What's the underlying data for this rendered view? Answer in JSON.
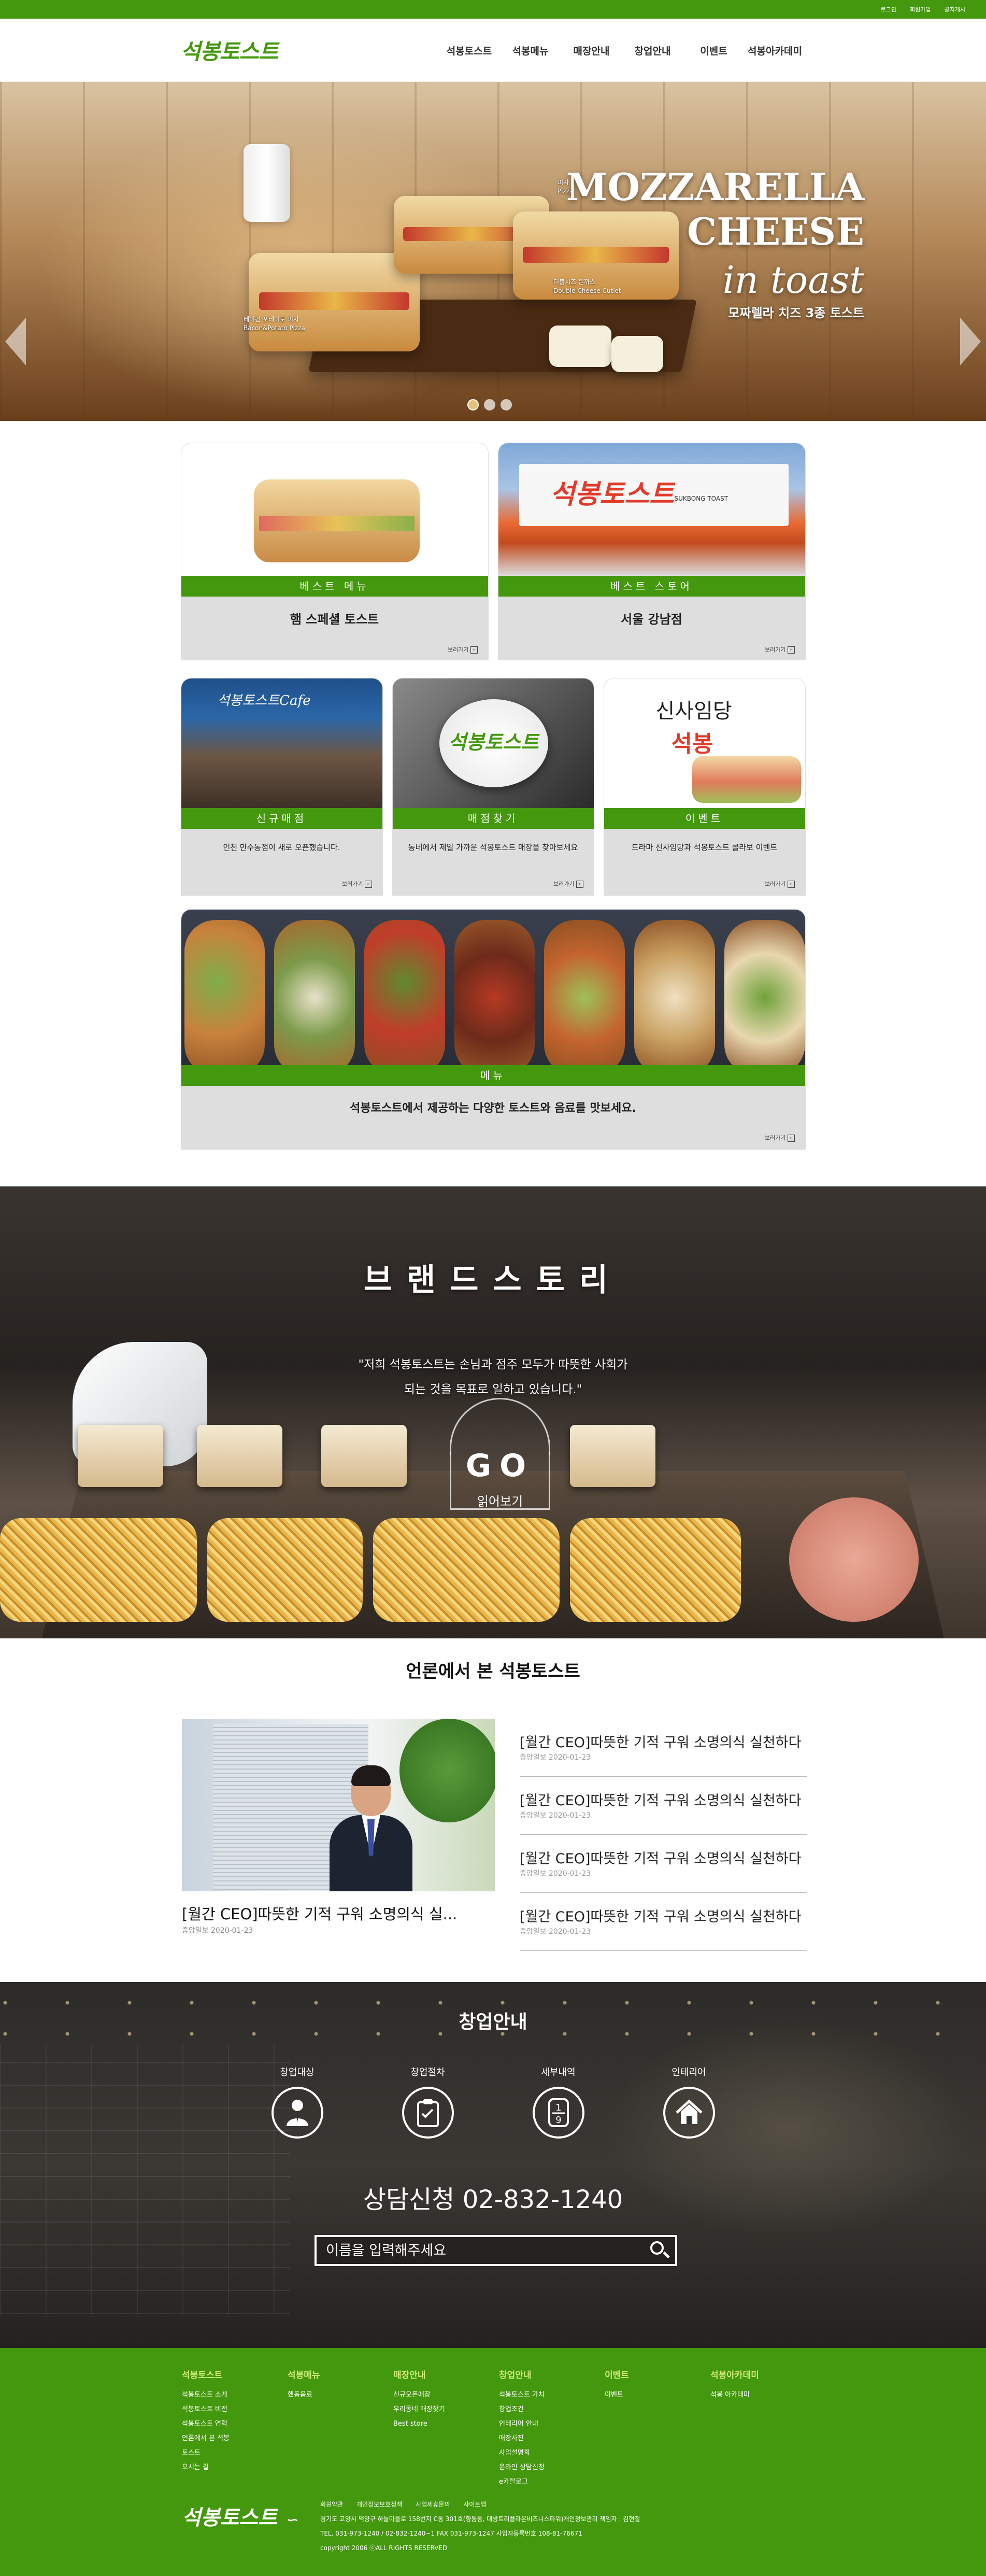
{
  "topbar": {
    "links": [
      "로그인",
      "회원가입",
      "공지게시"
    ]
  },
  "header": {
    "logo": "석봉토스트",
    "nav": [
      "석봉토스트",
      "석봉메뉴",
      "매장안내",
      "창업안내",
      "이벤트",
      "석봉아카데미"
    ]
  },
  "hero": {
    "title_line1": "MOZZARELLA",
    "title_line2": "CHEESE",
    "title_script": "in toast",
    "subtitle": "모짜렐라 치즈 3종 토스트",
    "labels": {
      "pizza": "피자",
      "pizza_en": "Pizza",
      "double_cheese": "더블치즈 돈까스",
      "double_cheese_en": "Double Cheese Cutlet",
      "bacon": "베이컨 포테이토 피자",
      "bacon_en": "Bacon&Potato Pizza"
    },
    "slides_total": 3,
    "active_slide": 1
  },
  "cards": {
    "best_menu": {
      "band": "베스트 메뉴",
      "title": "햄 스페셜 토스트",
      "more": "보러가기"
    },
    "best_store": {
      "band": "베스트 스토어",
      "title": "서울 강남점",
      "more": "보러가기",
      "sign": "석봉토스트",
      "sign_en": "SUKBONG TOAST"
    },
    "new_store": {
      "band": "신규매점",
      "desc": "인천 만수동점이 새로 오픈했습니다.",
      "more": "보러가기",
      "sign": "석봉토스트Cafe"
    },
    "find_store": {
      "band": "매점찾기",
      "desc": "동네에서 제일 가까운 석봉토스트 매장을 찾아보세요",
      "more": "보러가기",
      "sign": "석봉토스트"
    },
    "event": {
      "band": "이벤트",
      "desc": "드라마 신사임당과 석봉토스트 콜라보 이벤트",
      "more": "보러가기",
      "calligraphy1": "신사임당",
      "calligraphy2": "석봉"
    },
    "menu": {
      "band": "메뉴",
      "title": "석봉토스트에서 제공하는 다양한 토스트와 음료를 맛보세요.",
      "more": "보러가기"
    }
  },
  "story": {
    "title": "브랜드스토리",
    "quote_line1": "\"저희 석봉토스트는 손님과 점주 모두가 따뜻한 사회가",
    "quote_line2": "되는 것을 목표로 일하고 있습니다.\"",
    "go": "GO",
    "read_more": "읽어보기"
  },
  "press": {
    "section_title": "언론에서 본 석봉토스트",
    "featured": {
      "title": "[월간 CEO]따뜻한 기적 구워 소명의식 실...",
      "date": "중앙일보 2020-01-23"
    },
    "items": [
      {
        "title": "[월간 CEO]따뜻한 기적 구워 소명의식 실천하다",
        "date": "중앙일보 2020-01-23"
      },
      {
        "title": "[월간 CEO]따뜻한 기적 구워 소명의식 실천하다",
        "date": "중앙일보 2020-01-23"
      },
      {
        "title": "[월간 CEO]따뜻한 기적 구워 소명의식 실천하다",
        "date": "중앙일보 2020-01-23"
      },
      {
        "title": "[월간 CEO]따뜻한 기적 구워 소명의식 실천하다",
        "date": "중앙일보 2020-01-23"
      }
    ]
  },
  "startup": {
    "title": "창업안내",
    "icons": [
      {
        "label": "창업대상",
        "icon": "person-icon"
      },
      {
        "label": "창업절차",
        "icon": "clipboard-icon"
      },
      {
        "label": "세부내역",
        "icon": "fraction-icon"
      },
      {
        "label": "인테리어",
        "icon": "home-icon"
      }
    ],
    "phone": "상담신청 02-832-1240",
    "search_placeholder": "이름을 입력해주세요"
  },
  "footer": {
    "columns": [
      {
        "head": "석봉토스트",
        "items": [
          "석봉토스트 소개",
          "석봉토스트 비전",
          "석봉토스트 연혁",
          "언론에서 본 석봉",
          "토스트",
          "오시는 길"
        ]
      },
      {
        "head": "석봉메뉴",
        "items": [
          "했동음료"
        ]
      },
      {
        "head": "매장안내",
        "items": [
          "신규오픈매장",
          "우리동네 매장찾기",
          "Best store"
        ]
      },
      {
        "head": "창업안내",
        "items": [
          "석봉토스트 가치",
          "창업조건",
          "인테리어 안내",
          "매장사진",
          "사업설명회",
          "온라인 상담신청",
          "e카탈로그"
        ]
      },
      {
        "head": "이벤트",
        "items": [
          "이벤트"
        ]
      },
      {
        "head": "석봉아카데미",
        "items": [
          "석봉 아카데미"
        ]
      }
    ],
    "logo": "석봉토스트",
    "policies": [
      "회원약관",
      "개인정보보호정책",
      "사업제휴문의",
      "사이트맵"
    ],
    "address": "경기도 고양시 덕양구 하늘마을로 158번지 C동 301호(향동동, 대방트리플라온비즈니스타워)개인정보관리 책임자 : 김현철",
    "contact": "TEL. 031-973-1240 / 02-832-1240~1   FAX 031-973-1247   사업자등록번호 108-81-76671",
    "copyright": "copyright 2006 ⓒALL RIGHTS RESERVED"
  }
}
